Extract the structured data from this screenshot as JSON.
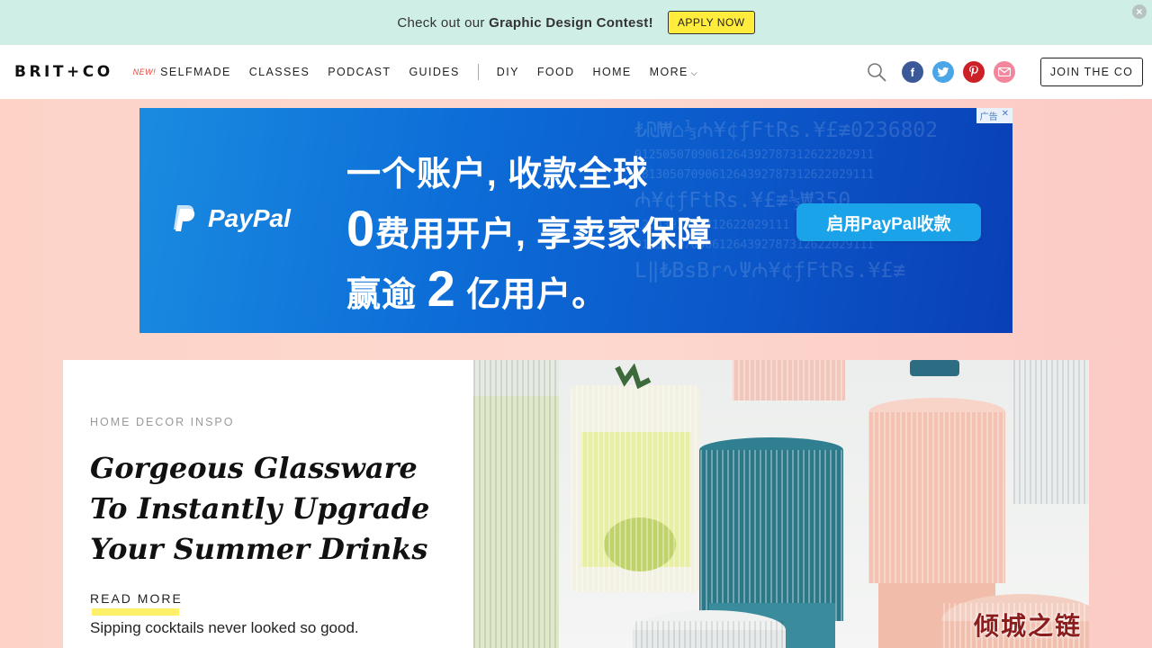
{
  "promo": {
    "text_prefix": "Check out our ",
    "text_bold": "Graphic Design Contest!",
    "button_label": "APPLY NOW",
    "close_label": "×"
  },
  "header": {
    "logo": "BRIT+CO",
    "nav": {
      "new_tag": "NEW!",
      "items": [
        "SELFMADE",
        "CLASSES",
        "PODCAST",
        "GUIDES",
        "DIY",
        "FOOD",
        "HOME",
        "MORE"
      ]
    },
    "social_icons": [
      "facebook-icon",
      "twitter-icon",
      "pinterest-icon",
      "email-icon"
    ],
    "join_label": "JOIN THE CO"
  },
  "ad": {
    "tag_label": "广告",
    "tag_close": "✕",
    "brand": "PayPal",
    "line1": "一个账户, 收款全球",
    "line2_num": "0",
    "line2_text": "费用开户, 享卖家保障",
    "line3_prefix": "赢逾 ",
    "line3_num": "2",
    "line3_suffix": " 亿用户。",
    "cta": "启用PayPal收款",
    "colors": {
      "background": "#0d6ed8",
      "cta": "#1aa3e8"
    }
  },
  "feature": {
    "category": "HOME DECOR INSPO",
    "headline": "Gorgeous Glassware To Instantly Upgrade Your Summer Drinks",
    "read_more": "READ MORE",
    "dek": "Sipping cocktails never looked so good."
  },
  "watermark": "倾城之链"
}
